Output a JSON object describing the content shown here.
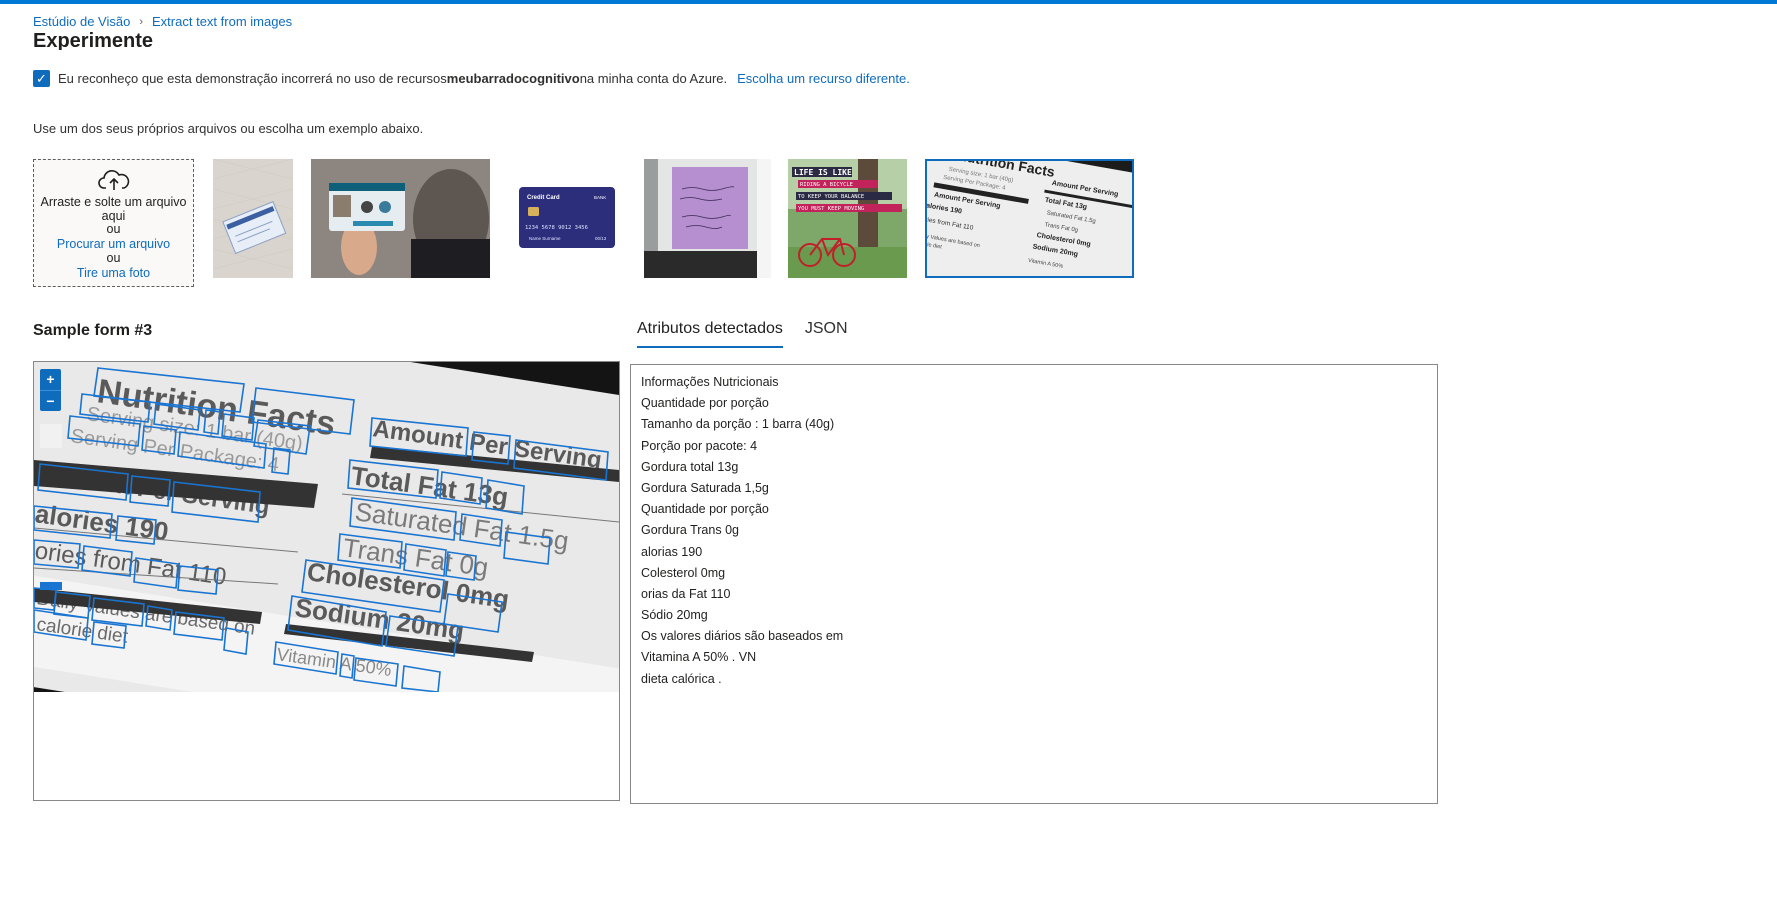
{
  "breadcrumb": {
    "home": "Estúdio de Visão",
    "current": "Extract text from images"
  },
  "page_heading": "Experimente",
  "acknowledgement": {
    "checked": true,
    "text_before": "Eu reconheço que esta demonstração incorrerá no uso de recursos",
    "resource_name": "meubarradocognitivo",
    "text_after": "na minha conta do Azure.",
    "change_link": "Escolha um recurso diferente."
  },
  "hint": "Use um dos seus próprios arquivos ou escolha um exemplo abaixo.",
  "dropzone": {
    "line1": "Arraste e solte um arquivo",
    "line2": "aqui",
    "or1": "ou",
    "browse_link": "Procurar um arquivo",
    "or2": "ou",
    "photo_link": "Tire uma foto"
  },
  "samples": [
    {
      "name": "social-security-card"
    },
    {
      "name": "identity-card"
    },
    {
      "name": "credit-card",
      "label_top": "Credit Card",
      "bank": "BANK",
      "number": "1234 5678 9012 3456",
      "holder": "Name Surname",
      "expiry": "00/13"
    },
    {
      "name": "handwritten-note"
    },
    {
      "name": "bicycle-poster",
      "lines": [
        "LIFE IS LIKE",
        "RIDING A BICYCLE",
        "TO KEEP YOUR BALANCE",
        "YOU MUST KEEP MOVING"
      ]
    },
    {
      "name": "nutrition-facts",
      "selected": true
    }
  ],
  "form_title": "Sample form #3",
  "tabs": {
    "attributes": "Atributos detectados",
    "json": "JSON",
    "active": "attributes"
  },
  "zoom": {
    "in": "+",
    "out": "−"
  },
  "detected_lines": [
    "Informações Nutricionais",
    "Quantidade por porção",
    "Tamanho da porção : 1 barra (40g)",
    "Porção por pacote: 4",
    "Gordura total 13g",
    "Gordura Saturada 1,5g",
    "Quantidade por porção",
    "Gordura Trans 0g",
    "alorias 190",
    "Colesterol 0mg",
    "orias da Fat 110",
    "Sódio 20mg",
    "Os valores diários são baseados em",
    "Vitamina A 50% . VN",
    "dieta calórica ."
  ],
  "nutrition_words": {
    "title": "Nutrition Facts",
    "serving_size": "Serving size: 1 bar (40g)",
    "servings": "Serving Per Package: 4",
    "amount_left": "Amount Per Serving",
    "amount_right": "Amount Per Serving",
    "calories": "alories 190",
    "from_fat": "ories from Fat 110",
    "total_fat": "Total Fat 13g",
    "saturated": "Saturated Fat 1.5g",
    "trans": "Trans Fat 0g",
    "cholesterol": "Cholesterol 0mg",
    "sodium": "Sodium 20mg",
    "daily": "Daily Values are based on",
    "calorie_diet": "calorie diet",
    "vitamin": "Vitamin A 50%"
  }
}
